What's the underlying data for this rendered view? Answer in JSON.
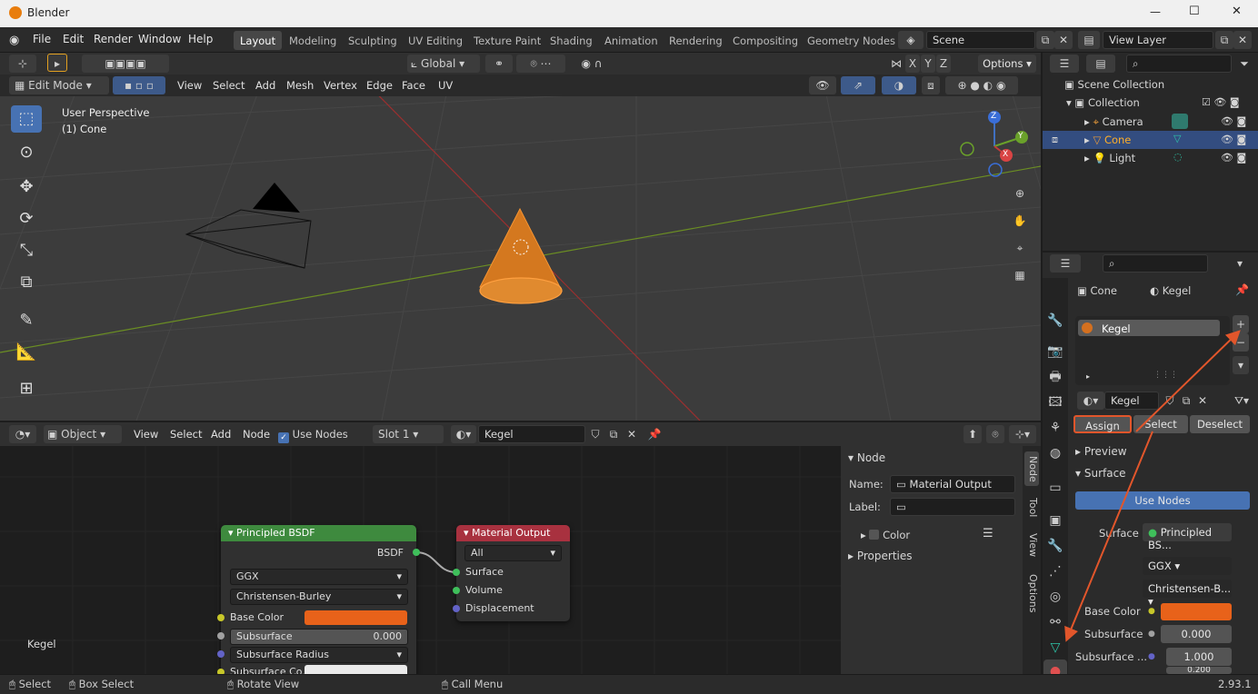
{
  "window": {
    "title": "Blender",
    "min": "—",
    "max": "☐",
    "close": "✕"
  },
  "menu": {
    "file": "File",
    "edit": "Edit",
    "render": "Render",
    "window": "Window",
    "help": "Help"
  },
  "workspaces": [
    "Layout",
    "Modeling",
    "Sculpting",
    "UV Editing",
    "Texture Paint",
    "Shading",
    "Animation",
    "Rendering",
    "Compositing",
    "Geometry Nodes"
  ],
  "scene": {
    "name": "Scene",
    "view_layer": "View Layer"
  },
  "viewport": {
    "transform_orientation": "Global",
    "options_label": "Options",
    "axis_x": "X",
    "axis_y": "Y",
    "axis_z": "Z",
    "mode": "Edit Mode",
    "menus": [
      "View",
      "Select",
      "Add",
      "Mesh",
      "Vertex",
      "Edge",
      "Face",
      "UV"
    ],
    "perspective": "User Perspective",
    "object_label": "(1) Cone",
    "gizmo": {
      "z": "Z",
      "y": "Y",
      "x": "X"
    }
  },
  "outliner": {
    "root": "Scene Collection",
    "collection": "Collection",
    "items": [
      {
        "label": "Camera"
      },
      {
        "label": "Cone"
      },
      {
        "label": "Light"
      }
    ]
  },
  "properties": {
    "breadcrumb_object": "Cone",
    "breadcrumb_material": "Kegel",
    "slot_name": "Kegel",
    "material_name": "Kegel",
    "assign": "Assign",
    "select": "Select",
    "deselect": "Deselect",
    "preview": "Preview",
    "surface_section": "Surface",
    "use_nodes": "Use Nodes",
    "surface_label": "Surface",
    "surface_value": "Principled BS...",
    "distribution": "GGX",
    "subsurface_method": "Christensen-B...",
    "base_color_label": "Base Color",
    "subsurface_label": "Subsurface",
    "subsurface_value": "0.000",
    "subsurface_radius_label": "Subsurface ...",
    "subsurface_radius_value": "1.000",
    "subsurface_radius_value2": "0.200",
    "base_color": "#e8621a"
  },
  "node_editor": {
    "object_mode": "Object",
    "menus": [
      "View",
      "Select",
      "Add",
      "Node"
    ],
    "use_nodes": "Use Nodes",
    "slot": "Slot 1",
    "material": "Kegel",
    "material_label": "Kegel",
    "bsdf": {
      "title": "Principled BSDF",
      "output": "BSDF",
      "distribution": "GGX",
      "sss": "Christensen-Burley",
      "base_color": "Base Color",
      "subsurface": "Subsurface",
      "subsurface_value": "0.000",
      "subsurface_radius": "Subsurface Radius",
      "subsurface_color": "Subsurface Co..."
    },
    "output": {
      "title": "Material Output",
      "target": "All",
      "surface": "Surface",
      "volume": "Volume",
      "displacement": "Displacement"
    },
    "panel": {
      "title": "Node",
      "name_label": "Name:",
      "name_value": "Material Output",
      "label_label": "Label:",
      "color": "Color",
      "properties": "Properties"
    },
    "tabs": [
      "Node",
      "Tool",
      "View",
      "Options"
    ]
  },
  "status": {
    "select": "Select",
    "box_select": "Box Select",
    "rotate": "Rotate View",
    "call_menu": "Call Menu",
    "version": "2.93.1"
  },
  "colors": {
    "accent": "#4772b3",
    "highlight_box": "#e2562b",
    "arrow": "#e2562b",
    "bsdf_header": "#3e8a3e",
    "output_header": "#a8313f"
  }
}
